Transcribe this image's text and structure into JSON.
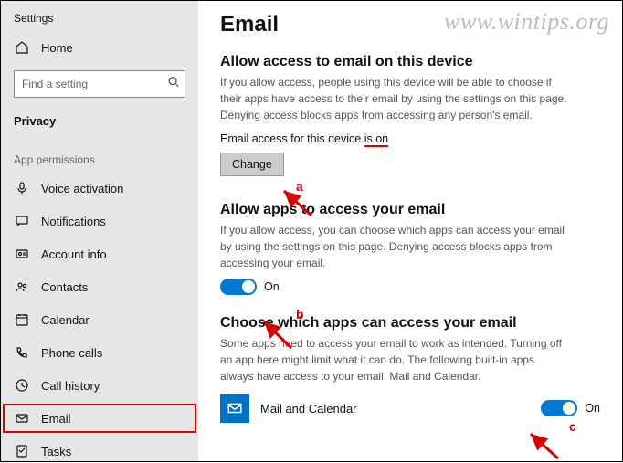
{
  "app_title": "Settings",
  "home_label": "Home",
  "search_placeholder": "Find a setting",
  "privacy_label": "Privacy",
  "app_permissions_label": "App permissions",
  "nav": [
    {
      "label": "Voice activation"
    },
    {
      "label": "Notifications"
    },
    {
      "label": "Account info"
    },
    {
      "label": "Contacts"
    },
    {
      "label": "Calendar"
    },
    {
      "label": "Phone calls"
    },
    {
      "label": "Call history"
    },
    {
      "label": "Email"
    },
    {
      "label": "Tasks"
    }
  ],
  "page": {
    "title": "Email",
    "s1_title": "Allow access to email on this device",
    "s1_body": "If you allow access, people using this device will be able to choose if their apps have access to their email by using the settings on this page. Denying access blocks apps from accessing any person's email.",
    "status_prefix": "Email access for this device ",
    "status_value": "is on",
    "change_btn": "Change",
    "s2_title": "Allow apps to access your email",
    "s2_body": "If you allow access, you can choose which apps can access your email by using the settings on this page. Denying access blocks apps from accessing your email.",
    "toggle_on_label": "On",
    "s3_title": "Choose which apps can access your email",
    "s3_body": "Some apps need to access your email to work as intended. Turning off an app here might limit what it can do. The following built-in apps always have access to your email: Mail and Calendar.",
    "app_item_label": "Mail and Calendar"
  },
  "annotations": {
    "a": "a",
    "b": "b",
    "c": "c"
  },
  "watermark": "www.wintips.org"
}
